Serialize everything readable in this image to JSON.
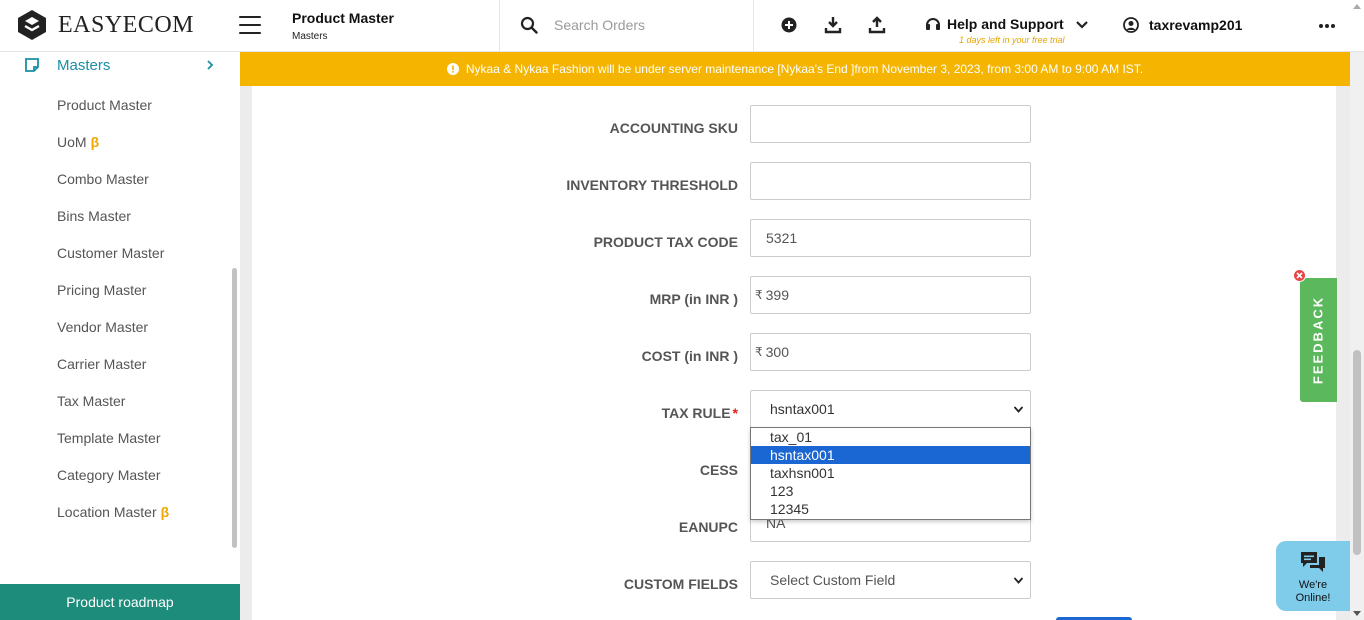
{
  "app": {
    "logo_text": "EASYECOM",
    "page_title": "Product Master",
    "page_breadcrumb": "Masters"
  },
  "header": {
    "search_placeholder": "Search Orders",
    "help_label": "Help and Support",
    "trial_text": "1 days left in your free trial",
    "username": "taxrevamp201"
  },
  "sidebar": {
    "section_label": "Masters",
    "items": [
      {
        "label": "Product Master",
        "beta": ""
      },
      {
        "label": "UoM",
        "beta": "β"
      },
      {
        "label": "Combo Master",
        "beta": ""
      },
      {
        "label": "Bins Master",
        "beta": ""
      },
      {
        "label": "Customer Master",
        "beta": ""
      },
      {
        "label": "Pricing Master",
        "beta": ""
      },
      {
        "label": "Vendor Master",
        "beta": ""
      },
      {
        "label": "Carrier Master",
        "beta": ""
      },
      {
        "label": "Tax Master",
        "beta": ""
      },
      {
        "label": "Template Master",
        "beta": ""
      },
      {
        "label": "Category Master",
        "beta": ""
      },
      {
        "label": "Location Master",
        "beta": "β"
      }
    ],
    "roadmap_label": "Product roadmap"
  },
  "banner": {
    "text": "Nykaa & Nykaa Fashion will be under server maintenance [Nykaa's End ]from November 3, 2023, from 3:00 AM to 9:00 AM IST."
  },
  "form": {
    "accounting_sku": {
      "label": "ACCOUNTING SKU",
      "value": ""
    },
    "inventory_threshold": {
      "label": "INVENTORY THRESHOLD",
      "value": ""
    },
    "product_tax_code": {
      "label": "PRODUCT TAX CODE",
      "value": "5321"
    },
    "mrp": {
      "label": "MRP (in INR )",
      "currency": "₹",
      "value": "399"
    },
    "cost": {
      "label": "COST (in INR )",
      "currency": "₹",
      "value": "300"
    },
    "tax_rule": {
      "label": "TAX RULE",
      "required_mark": "*",
      "selected": "hsntax001",
      "options": [
        "tax_01",
        "hsntax001",
        "taxhsn001",
        "123",
        "12345"
      ]
    },
    "cess": {
      "label": "CESS"
    },
    "eanupc": {
      "label": "EANUPC",
      "value": "NA"
    },
    "custom_fields": {
      "label": "CUSTOM FIELDS",
      "placeholder": "Select Custom Field"
    }
  },
  "widgets": {
    "feedback_label": "FEEDBACK",
    "chat_line1": "We're",
    "chat_line2": "Online!"
  },
  "colors": {
    "accent_teal": "#1a8fa5",
    "banner": "#f4b400",
    "roadmap": "#1e8c7b",
    "feedback": "#5cb85c",
    "chat": "#7ecbea",
    "selected_option": "#1a66d2"
  }
}
